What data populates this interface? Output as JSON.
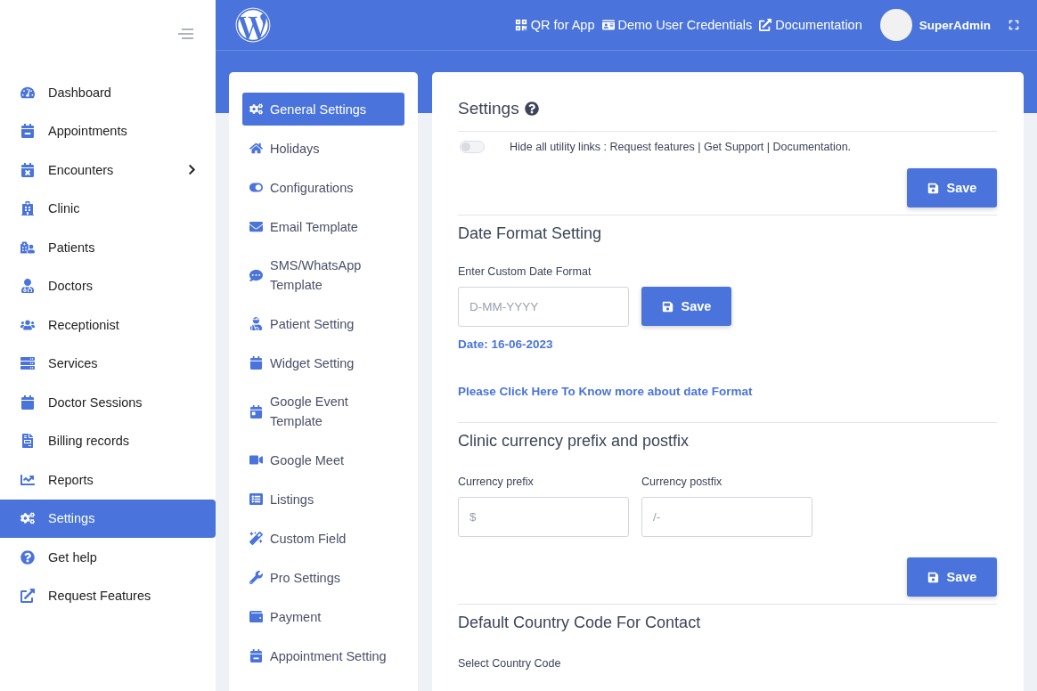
{
  "sidebar": {
    "items": [
      {
        "label": "Dashboard",
        "selected": false
      },
      {
        "label": "Appointments",
        "selected": false
      },
      {
        "label": "Encounters",
        "selected": false,
        "expanded": false
      },
      {
        "label": "Clinic",
        "selected": false
      },
      {
        "label": "Patients",
        "selected": false
      },
      {
        "label": "Doctors",
        "selected": false
      },
      {
        "label": "Receptionist",
        "selected": false
      },
      {
        "label": "Services",
        "selected": false
      },
      {
        "label": "Doctor Sessions",
        "selected": false
      },
      {
        "label": "Billing records",
        "selected": false
      },
      {
        "label": "Reports",
        "selected": false
      },
      {
        "label": "Settings",
        "selected": true
      },
      {
        "label": "Get help",
        "selected": false
      },
      {
        "label": "Request Features",
        "selected": false
      }
    ]
  },
  "header": {
    "links": [
      "QR for App",
      "Demo User Credentials",
      "Documentation"
    ],
    "user": "SuperAdmin"
  },
  "settings_nav": {
    "items": [
      {
        "label": "General Settings",
        "selected": true
      },
      {
        "label": "Holidays",
        "selected": false
      },
      {
        "label": "Configurations",
        "selected": false
      },
      {
        "label": "Email Template",
        "selected": false
      },
      {
        "label": "SMS/WhatsApp Template",
        "selected": false
      },
      {
        "label": "Patient Setting",
        "selected": false
      },
      {
        "label": "Widget Setting",
        "selected": false
      },
      {
        "label": "Google Event Template",
        "selected": false
      },
      {
        "label": "Google Meet",
        "selected": false
      },
      {
        "label": "Listings",
        "selected": false
      },
      {
        "label": "Custom Field",
        "selected": false
      },
      {
        "label": "Pro Settings",
        "selected": false
      },
      {
        "label": "Payment",
        "selected": false
      },
      {
        "label": "Appointment Setting",
        "selected": false
      }
    ]
  },
  "main": {
    "title": "Settings",
    "utility_toggle": {
      "label": "Hide all utility links : Request features | Get Support | Documentation.",
      "on": false
    },
    "save_label": "Save",
    "date_format": {
      "heading": "Date Format Setting",
      "field_label": "Enter Custom Date Format",
      "placeholder": "D-MM-YYYY",
      "button": "Save",
      "preview": "Date: 16-06-2023",
      "help_link": "Please Click Here To Know more about date Format"
    },
    "currency": {
      "heading": "Clinic currency prefix and postfix",
      "prefix_label": "Currency prefix",
      "prefix_placeholder": "$",
      "postfix_label": "Currency postfix",
      "postfix_placeholder": "/-",
      "button": "Save"
    },
    "country_code": {
      "heading": "Default Country Code For Contact",
      "field_label": "Select Country Code"
    }
  }
}
